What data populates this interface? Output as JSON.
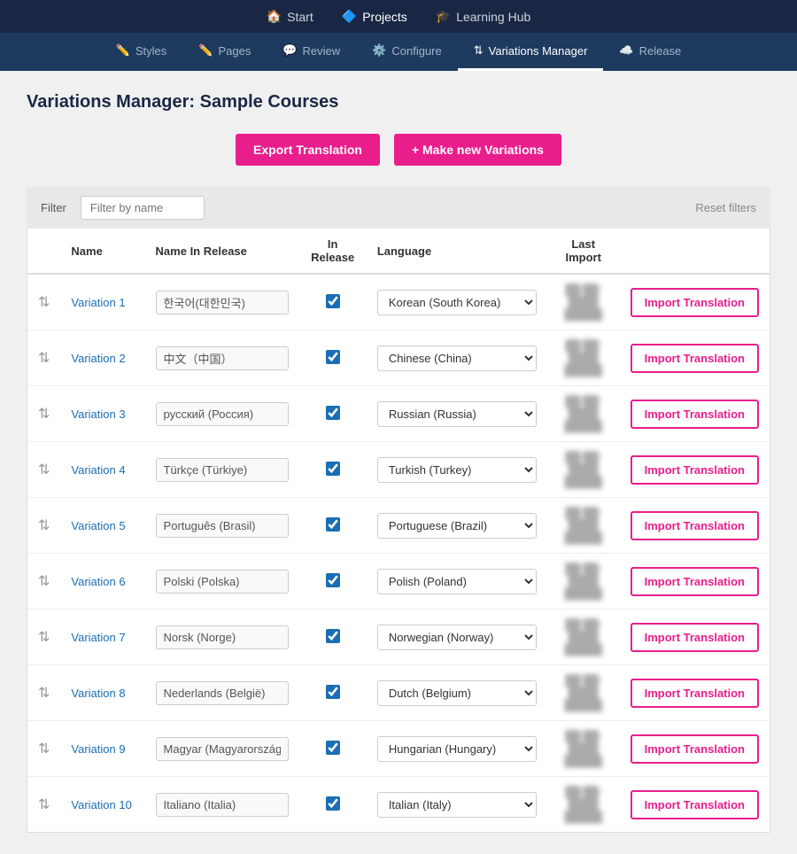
{
  "topNav": {
    "items": [
      {
        "label": "Start",
        "icon": "🏠",
        "active": false
      },
      {
        "label": "Projects",
        "icon": "🔷",
        "active": true
      },
      {
        "label": "Learning Hub",
        "icon": "🎓",
        "active": false
      }
    ]
  },
  "secondNav": {
    "items": [
      {
        "label": "Styles",
        "icon": "✏️",
        "active": false
      },
      {
        "label": "Pages",
        "icon": "✏️",
        "active": false
      },
      {
        "label": "Review",
        "icon": "💬",
        "active": false
      },
      {
        "label": "Configure",
        "icon": "⚙️",
        "active": false
      },
      {
        "label": "Variations Manager",
        "icon": "⇅",
        "active": true
      },
      {
        "label": "Release",
        "icon": "☁️",
        "active": false
      }
    ]
  },
  "pageTitle": "Variations Manager: Sample Courses",
  "buttons": {
    "export": "Export Translation",
    "newVariations": "+ Make new Variations",
    "importTranslation": "Import Translation"
  },
  "filter": {
    "label": "Filter",
    "placeholder": "Filter by name",
    "resetLabel": "Reset filters"
  },
  "tableHeaders": {
    "name": "Name",
    "nameInRelease": "Name In Release",
    "inRelease": "In Release",
    "language": "Language",
    "lastImport": "Last Import"
  },
  "variations": [
    {
      "id": 1,
      "name": "Variation 1",
      "nameInRelease": "한국어(대한민국)",
      "inRelease": true,
      "language": "Korean (South Korea)"
    },
    {
      "id": 2,
      "name": "Variation 2",
      "nameInRelease": "中文（中国）",
      "inRelease": true,
      "language": "Chinese (China)"
    },
    {
      "id": 3,
      "name": "Variation 3",
      "nameInRelease": "русский (Россия)",
      "inRelease": true,
      "language": "Russian (Russia)"
    },
    {
      "id": 4,
      "name": "Variation 4",
      "nameInRelease": "Türkçe (Türkiye)",
      "inRelease": true,
      "language": "Turkish (Turkey)"
    },
    {
      "id": 5,
      "name": "Variation 5",
      "nameInRelease": "Português (Brasil)",
      "inRelease": true,
      "language": "Portuguese (Brazil)"
    },
    {
      "id": 6,
      "name": "Variation 6",
      "nameInRelease": "Polski (Polska)",
      "inRelease": true,
      "language": "Polish (Poland)"
    },
    {
      "id": 7,
      "name": "Variation 7",
      "nameInRelease": "Norsk (Norge)",
      "inRelease": true,
      "language": "Norwegian (Norway)"
    },
    {
      "id": 8,
      "name": "Variation 8",
      "nameInRelease": "Nederlands (België)",
      "inRelease": true,
      "language": "Dutch (Belgium)"
    },
    {
      "id": 9,
      "name": "Variation 9",
      "nameInRelease": "Magyar (Magyarország)",
      "inRelease": true,
      "language": "Hungarian (Hungary)"
    },
    {
      "id": 10,
      "name": "Variation 10",
      "nameInRelease": "Italiano (Italia)",
      "inRelease": true,
      "language": "Italian (Italy)"
    }
  ]
}
